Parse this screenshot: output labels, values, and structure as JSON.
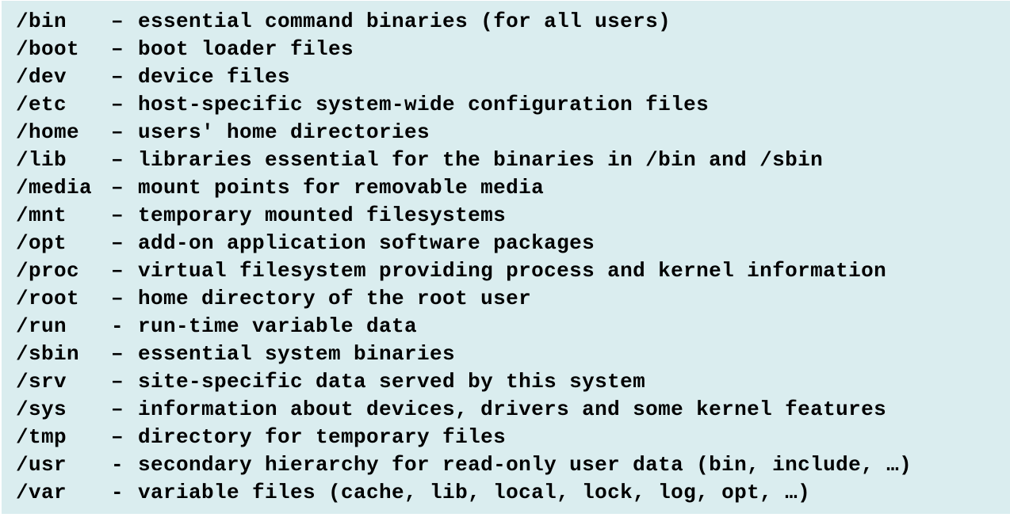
{
  "entries": [
    {
      "path": "/bin",
      "sep": "–",
      "desc": "essential command binaries (for all users)"
    },
    {
      "path": "/boot",
      "sep": "–",
      "desc": "boot loader files"
    },
    {
      "path": "/dev",
      "sep": "–",
      "desc": "device files"
    },
    {
      "path": "/etc",
      "sep": "–",
      "desc": "host-specific system-wide configuration files"
    },
    {
      "path": "/home",
      "sep": "–",
      "desc": "users' home directories"
    },
    {
      "path": "/lib",
      "sep": "–",
      "desc": "libraries essential for the binaries in /bin and /sbin"
    },
    {
      "path": "/media",
      "sep": "–",
      "desc": "mount points for removable media"
    },
    {
      "path": "/mnt",
      "sep": "–",
      "desc": "temporary mounted filesystems"
    },
    {
      "path": "/opt",
      "sep": "–",
      "desc": "add-on application software packages"
    },
    {
      "path": "/proc",
      "sep": "–",
      "desc": "virtual filesystem providing process and kernel information"
    },
    {
      "path": "/root",
      "sep": "–",
      "desc": "home directory of the root user"
    },
    {
      "path": "/run",
      "sep": "-",
      "desc": "run-time variable data"
    },
    {
      "path": "/sbin",
      "sep": "–",
      "desc": "essential system binaries"
    },
    {
      "path": "/srv",
      "sep": "–",
      "desc": "site-specific data served by this system"
    },
    {
      "path": "/sys",
      "sep": "–",
      "desc": "information about devices, drivers and some kernel features"
    },
    {
      "path": "/tmp",
      "sep": "–",
      "desc": "directory for temporary files"
    },
    {
      "path": "/usr",
      "sep": "-",
      "desc": "secondary hierarchy for read-only user data (bin, include, …)"
    },
    {
      "path": "/var",
      "sep": "-",
      "desc": "variable files (cache, lib, local, lock, log, opt, …)"
    }
  ]
}
